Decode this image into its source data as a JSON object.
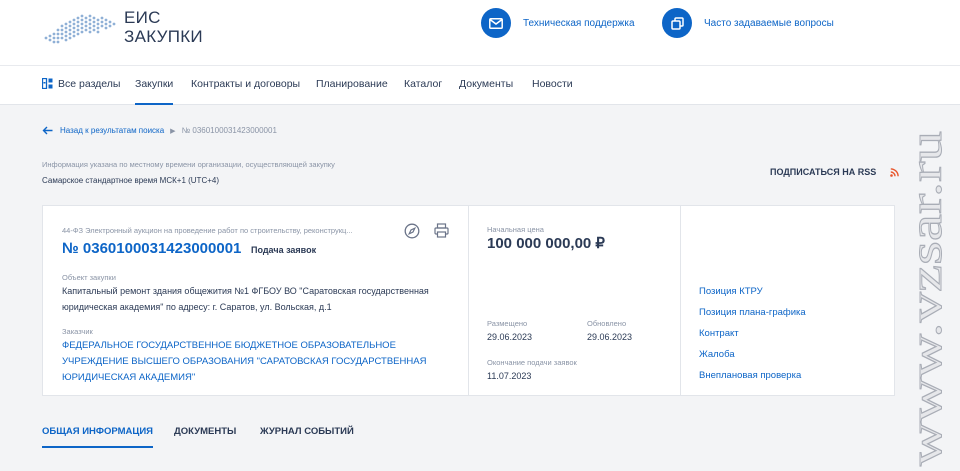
{
  "header": {
    "logo_line1": "ЕИС",
    "logo_line2": "ЗАКУПКИ",
    "support_label": "Техническая поддержка",
    "faq_label": "Часто задаваемые вопросы"
  },
  "nav": {
    "items": [
      {
        "label": "Все разделы",
        "icon": "sections-grid-icon"
      },
      {
        "label": "Закупки",
        "active": true
      },
      {
        "label": "Контракты и договоры"
      },
      {
        "label": "Планирование"
      },
      {
        "label": "Каталог"
      },
      {
        "label": "Документы"
      },
      {
        "label": "Новости"
      }
    ]
  },
  "breadcrumb": {
    "back_label": "Назад к результатам поиска",
    "current": "№ 0360100031423000001"
  },
  "timezone": {
    "note": "Информация указана по местному времени организации, осуществляющей закупку",
    "value": "Самарское стандартное время МСК+1 (UTC+4)"
  },
  "rss_label": "ПОДПИСАТЬСЯ НА RSS",
  "card": {
    "lead": "44-ФЗ Электронный аукцион на проведение работ по строительству, реконструкц...",
    "number": "№ 0360100031423000001",
    "status": "Подача заявок",
    "object_label": "Объект закупки",
    "object_value": "Капитальный ремонт здания общежития №1 ФГБОУ ВО \"Саратовская государственная юридическая академия\" по адресу: г. Саратов, ул. Вольская, д.1",
    "customer_label": "Заказчик",
    "customer_value": "ФЕДЕРАЛЬНОЕ ГОСУДАРСТВЕННОЕ БЮДЖЕТНОЕ ОБРАЗОВАТЕЛЬНОЕ УЧРЕЖДЕНИЕ ВЫСШЕГО ОБРАЗОВАНИЯ \"САРАТОВСКАЯ ГОСУДАРСТВЕННАЯ ЮРИДИЧЕСКАЯ АКАДЕМИЯ\"",
    "price_label": "Начальная цена",
    "price_value": "100 000 000,00 ₽",
    "posted_label": "Размещено",
    "posted_value": "29.06.2023",
    "updated_label": "Обновлено",
    "updated_value": "29.06.2023",
    "deadline_label": "Окончание подачи заявок",
    "deadline_value": "11.07.2023",
    "links": [
      "Позиция КТРУ",
      "Позиция плана-графика",
      "Контракт",
      "Жалоба",
      "Внеплановая проверка"
    ]
  },
  "tabs": [
    {
      "label": "ОБЩАЯ ИНФОРМАЦИЯ",
      "active": true
    },
    {
      "label": "ДОКУМЕНТЫ"
    },
    {
      "label": "ЖУРНАЛ СОБЫТИЙ"
    }
  ],
  "watermark": "www.vzsar.ru",
  "colors": {
    "accent": "#0d65c7",
    "text": "#2b3a55",
    "muted": "#8a94a6",
    "rss": "#e8542a"
  }
}
